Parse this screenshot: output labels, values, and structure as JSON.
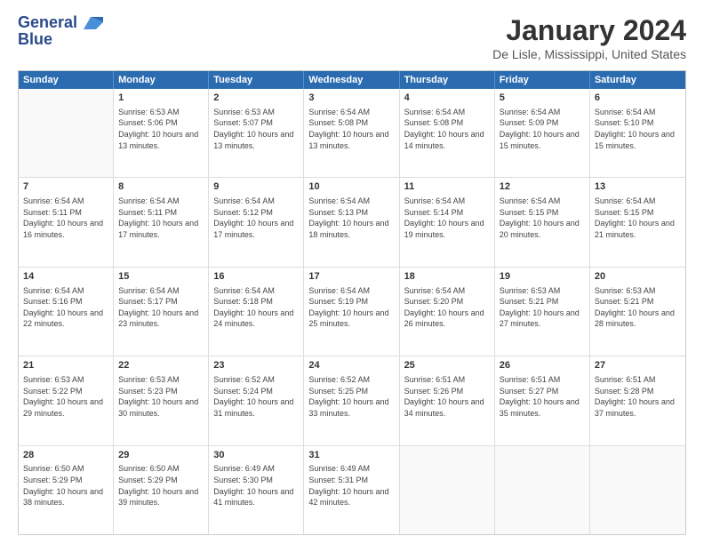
{
  "logo": {
    "line1": "General",
    "line2": "Blue"
  },
  "title": "January 2024",
  "subtitle": "De Lisle, Mississippi, United States",
  "header_days": [
    "Sunday",
    "Monday",
    "Tuesday",
    "Wednesday",
    "Thursday",
    "Friday",
    "Saturday"
  ],
  "rows": [
    [
      {
        "day": "",
        "sunrise": "",
        "sunset": "",
        "daylight": ""
      },
      {
        "day": "1",
        "sunrise": "Sunrise: 6:53 AM",
        "sunset": "Sunset: 5:06 PM",
        "daylight": "Daylight: 10 hours and 13 minutes."
      },
      {
        "day": "2",
        "sunrise": "Sunrise: 6:53 AM",
        "sunset": "Sunset: 5:07 PM",
        "daylight": "Daylight: 10 hours and 13 minutes."
      },
      {
        "day": "3",
        "sunrise": "Sunrise: 6:54 AM",
        "sunset": "Sunset: 5:08 PM",
        "daylight": "Daylight: 10 hours and 13 minutes."
      },
      {
        "day": "4",
        "sunrise": "Sunrise: 6:54 AM",
        "sunset": "Sunset: 5:08 PM",
        "daylight": "Daylight: 10 hours and 14 minutes."
      },
      {
        "day": "5",
        "sunrise": "Sunrise: 6:54 AM",
        "sunset": "Sunset: 5:09 PM",
        "daylight": "Daylight: 10 hours and 15 minutes."
      },
      {
        "day": "6",
        "sunrise": "Sunrise: 6:54 AM",
        "sunset": "Sunset: 5:10 PM",
        "daylight": "Daylight: 10 hours and 15 minutes."
      }
    ],
    [
      {
        "day": "7",
        "sunrise": "Sunrise: 6:54 AM",
        "sunset": "Sunset: 5:11 PM",
        "daylight": "Daylight: 10 hours and 16 minutes."
      },
      {
        "day": "8",
        "sunrise": "Sunrise: 6:54 AM",
        "sunset": "Sunset: 5:11 PM",
        "daylight": "Daylight: 10 hours and 17 minutes."
      },
      {
        "day": "9",
        "sunrise": "Sunrise: 6:54 AM",
        "sunset": "Sunset: 5:12 PM",
        "daylight": "Daylight: 10 hours and 17 minutes."
      },
      {
        "day": "10",
        "sunrise": "Sunrise: 6:54 AM",
        "sunset": "Sunset: 5:13 PM",
        "daylight": "Daylight: 10 hours and 18 minutes."
      },
      {
        "day": "11",
        "sunrise": "Sunrise: 6:54 AM",
        "sunset": "Sunset: 5:14 PM",
        "daylight": "Daylight: 10 hours and 19 minutes."
      },
      {
        "day": "12",
        "sunrise": "Sunrise: 6:54 AM",
        "sunset": "Sunset: 5:15 PM",
        "daylight": "Daylight: 10 hours and 20 minutes."
      },
      {
        "day": "13",
        "sunrise": "Sunrise: 6:54 AM",
        "sunset": "Sunset: 5:15 PM",
        "daylight": "Daylight: 10 hours and 21 minutes."
      }
    ],
    [
      {
        "day": "14",
        "sunrise": "Sunrise: 6:54 AM",
        "sunset": "Sunset: 5:16 PM",
        "daylight": "Daylight: 10 hours and 22 minutes."
      },
      {
        "day": "15",
        "sunrise": "Sunrise: 6:54 AM",
        "sunset": "Sunset: 5:17 PM",
        "daylight": "Daylight: 10 hours and 23 minutes."
      },
      {
        "day": "16",
        "sunrise": "Sunrise: 6:54 AM",
        "sunset": "Sunset: 5:18 PM",
        "daylight": "Daylight: 10 hours and 24 minutes."
      },
      {
        "day": "17",
        "sunrise": "Sunrise: 6:54 AM",
        "sunset": "Sunset: 5:19 PM",
        "daylight": "Daylight: 10 hours and 25 minutes."
      },
      {
        "day": "18",
        "sunrise": "Sunrise: 6:54 AM",
        "sunset": "Sunset: 5:20 PM",
        "daylight": "Daylight: 10 hours and 26 minutes."
      },
      {
        "day": "19",
        "sunrise": "Sunrise: 6:53 AM",
        "sunset": "Sunset: 5:21 PM",
        "daylight": "Daylight: 10 hours and 27 minutes."
      },
      {
        "day": "20",
        "sunrise": "Sunrise: 6:53 AM",
        "sunset": "Sunset: 5:21 PM",
        "daylight": "Daylight: 10 hours and 28 minutes."
      }
    ],
    [
      {
        "day": "21",
        "sunrise": "Sunrise: 6:53 AM",
        "sunset": "Sunset: 5:22 PM",
        "daylight": "Daylight: 10 hours and 29 minutes."
      },
      {
        "day": "22",
        "sunrise": "Sunrise: 6:53 AM",
        "sunset": "Sunset: 5:23 PM",
        "daylight": "Daylight: 10 hours and 30 minutes."
      },
      {
        "day": "23",
        "sunrise": "Sunrise: 6:52 AM",
        "sunset": "Sunset: 5:24 PM",
        "daylight": "Daylight: 10 hours and 31 minutes."
      },
      {
        "day": "24",
        "sunrise": "Sunrise: 6:52 AM",
        "sunset": "Sunset: 5:25 PM",
        "daylight": "Daylight: 10 hours and 33 minutes."
      },
      {
        "day": "25",
        "sunrise": "Sunrise: 6:51 AM",
        "sunset": "Sunset: 5:26 PM",
        "daylight": "Daylight: 10 hours and 34 minutes."
      },
      {
        "day": "26",
        "sunrise": "Sunrise: 6:51 AM",
        "sunset": "Sunset: 5:27 PM",
        "daylight": "Daylight: 10 hours and 35 minutes."
      },
      {
        "day": "27",
        "sunrise": "Sunrise: 6:51 AM",
        "sunset": "Sunset: 5:28 PM",
        "daylight": "Daylight: 10 hours and 37 minutes."
      }
    ],
    [
      {
        "day": "28",
        "sunrise": "Sunrise: 6:50 AM",
        "sunset": "Sunset: 5:29 PM",
        "daylight": "Daylight: 10 hours and 38 minutes."
      },
      {
        "day": "29",
        "sunrise": "Sunrise: 6:50 AM",
        "sunset": "Sunset: 5:29 PM",
        "daylight": "Daylight: 10 hours and 39 minutes."
      },
      {
        "day": "30",
        "sunrise": "Sunrise: 6:49 AM",
        "sunset": "Sunset: 5:30 PM",
        "daylight": "Daylight: 10 hours and 41 minutes."
      },
      {
        "day": "31",
        "sunrise": "Sunrise: 6:49 AM",
        "sunset": "Sunset: 5:31 PM",
        "daylight": "Daylight: 10 hours and 42 minutes."
      },
      {
        "day": "",
        "sunrise": "",
        "sunset": "",
        "daylight": ""
      },
      {
        "day": "",
        "sunrise": "",
        "sunset": "",
        "daylight": ""
      },
      {
        "day": "",
        "sunrise": "",
        "sunset": "",
        "daylight": ""
      }
    ]
  ]
}
